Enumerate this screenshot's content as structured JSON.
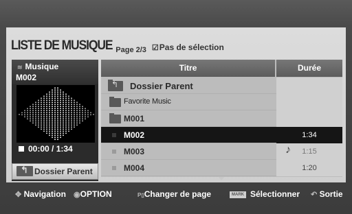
{
  "header": {
    "title": "LISTE DE MUSIQUE",
    "page_indicator": "Page 2/3",
    "no_selection_label": "Pas de sélection"
  },
  "left_panel": {
    "category": "Musique",
    "current_file": "M002",
    "time": "00:00 / 1:34",
    "parent_button": "Dossier Parent"
  },
  "table": {
    "columns": {
      "title": "Titre",
      "duration": "Durée"
    },
    "rows": [
      {
        "name": "Dossier Parent",
        "type": "parent",
        "duration": ""
      },
      {
        "name": "Favorite Music",
        "type": "folder",
        "duration": ""
      },
      {
        "name": "M001",
        "type": "folder",
        "duration": ""
      },
      {
        "name": "M002",
        "type": "file",
        "duration": "1:34",
        "selected": true
      },
      {
        "name": "M003",
        "type": "file",
        "duration": "1:15",
        "playing": true
      },
      {
        "name": "M004",
        "type": "file",
        "duration": "1:20"
      }
    ]
  },
  "footer": {
    "navigation": "Navigation",
    "option": "OPTION",
    "page_change": "Changer de page",
    "mark_label": "MARK",
    "select": "Sélectionner",
    "exit": "Sortie"
  }
}
